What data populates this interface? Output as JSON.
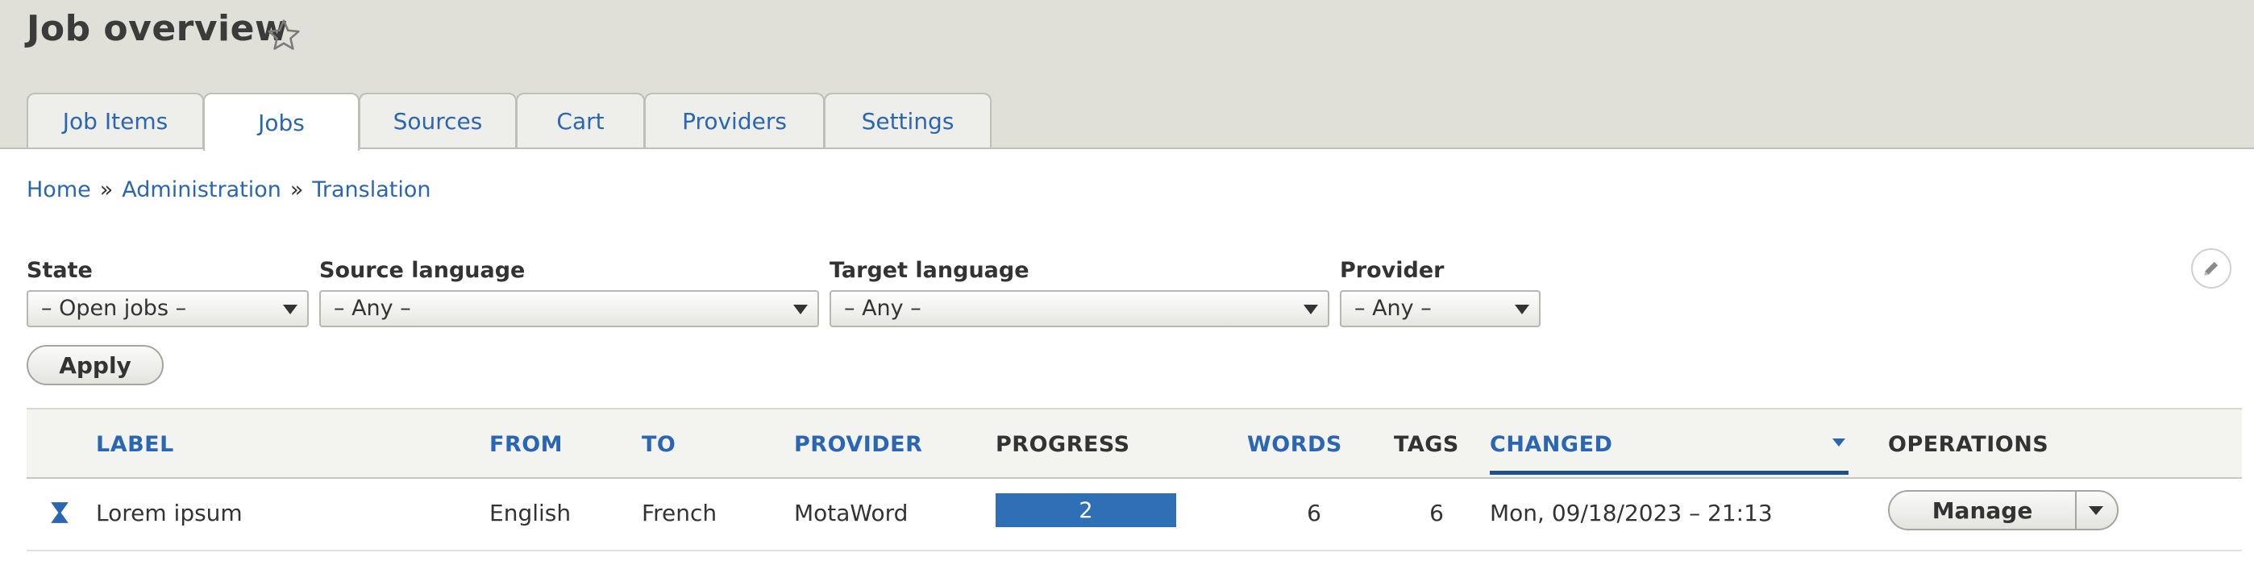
{
  "page": {
    "title": "Job overview"
  },
  "tabs": [
    {
      "label": "Job Items"
    },
    {
      "label": "Jobs",
      "active": true
    },
    {
      "label": "Sources"
    },
    {
      "label": "Cart"
    },
    {
      "label": "Providers"
    },
    {
      "label": "Settings"
    }
  ],
  "breadcrumb": {
    "items": [
      "Home",
      "Administration",
      "Translation"
    ],
    "separator": "»"
  },
  "filters": {
    "state": {
      "label": "State",
      "value": "– Open jobs –"
    },
    "source_language": {
      "label": "Source language",
      "value": "– Any –"
    },
    "target_language": {
      "label": "Target language",
      "value": "– Any –"
    },
    "provider": {
      "label": "Provider",
      "value": "– Any –"
    },
    "apply_label": "Apply"
  },
  "table": {
    "columns": {
      "label": "LABEL",
      "from": "FROM",
      "to": "TO",
      "provider": "PROVIDER",
      "progress": "PROGRESS",
      "words": "WORDS",
      "tags": "TAGS",
      "changed": "CHANGED",
      "operations": "OPERATIONS"
    },
    "rows": [
      {
        "state_icon": "hourglass-icon",
        "label": "Lorem ipsum",
        "from": "English",
        "to": "French",
        "provider": "MotaWord",
        "progress": "2",
        "words": "6",
        "tags": "6",
        "changed": "Mon, 09/18/2023 – 21:13",
        "operation": "Manage"
      }
    ]
  },
  "colors": {
    "link": "#2a66b3",
    "progress_bar": "#2f6fb5",
    "header_bg": "#e0e0d8"
  }
}
